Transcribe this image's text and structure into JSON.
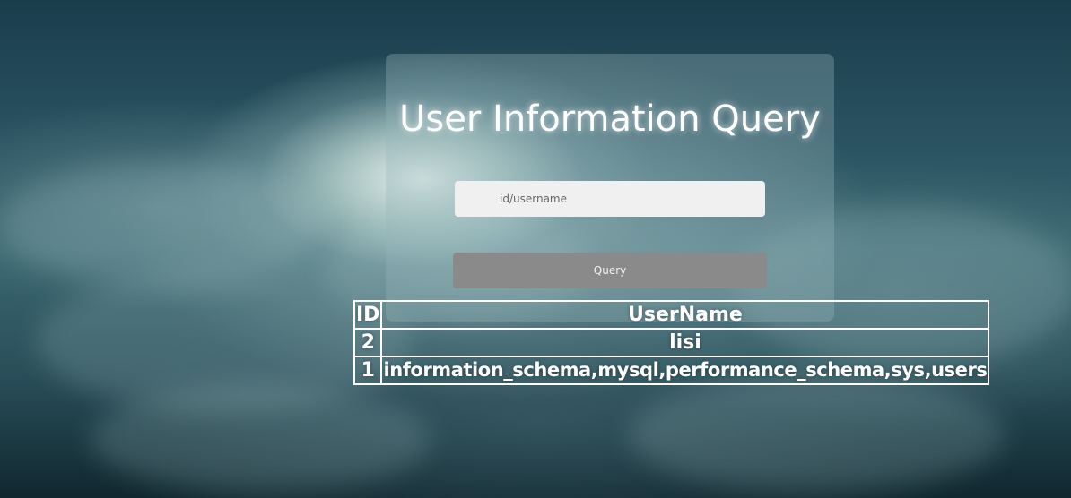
{
  "page": {
    "title": "User Information Query"
  },
  "search": {
    "placeholder": "id/username",
    "value": ""
  },
  "query_button": {
    "label": "Query"
  },
  "results_table": {
    "headers": [
      "ID",
      "UserName"
    ],
    "rows": [
      {
        "id": "2",
        "username": "lisi"
      },
      {
        "id": "1",
        "username": "information_schema,mysql,performance_schema,sys,users"
      }
    ]
  },
  "colors": {
    "panel": "#96b4b9",
    "input_bg": "#f0f0f0",
    "button_bg": "#8a8a8a",
    "text": "#ffffff"
  }
}
